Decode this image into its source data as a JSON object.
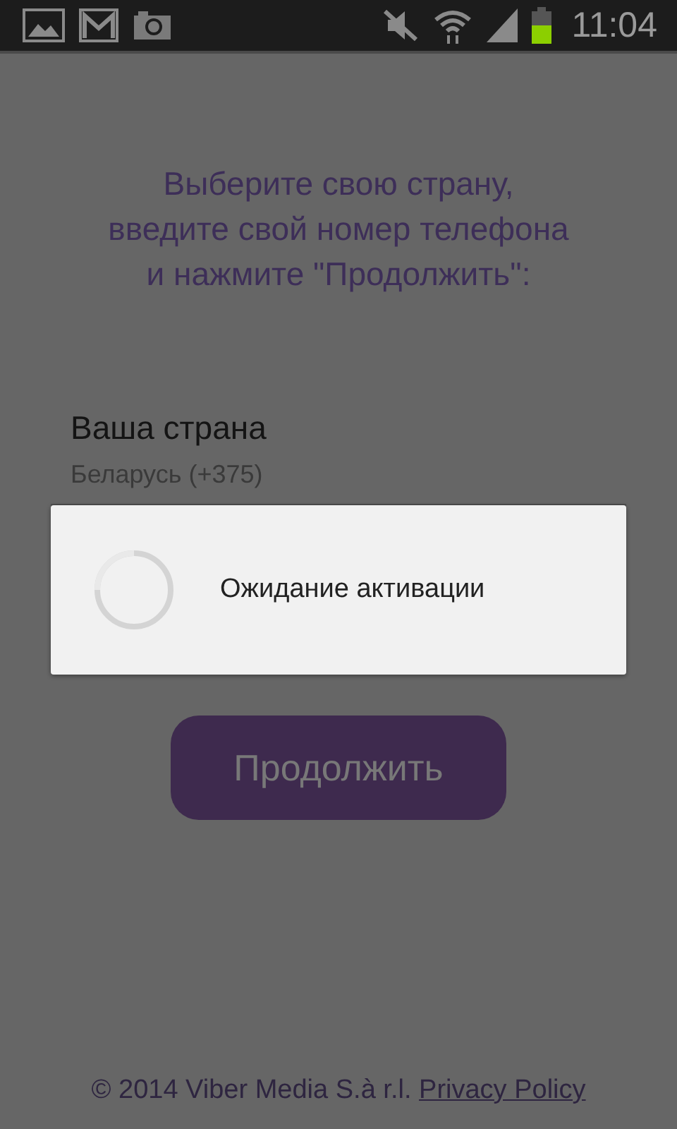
{
  "status_bar": {
    "time": "11:04"
  },
  "instructions": "Выберите свою страну,\nвведите свой номер телефона\nи нажмите \"Продолжить\":",
  "country_field": {
    "label": "Ваша страна",
    "value": "Беларусь (+375)"
  },
  "continue_button": {
    "label": "Продолжить"
  },
  "dialog": {
    "message": "Ожидание активации"
  },
  "footer": {
    "copyright": "© 2014 Viber Media S.à r.l.",
    "link": "Privacy Policy"
  }
}
